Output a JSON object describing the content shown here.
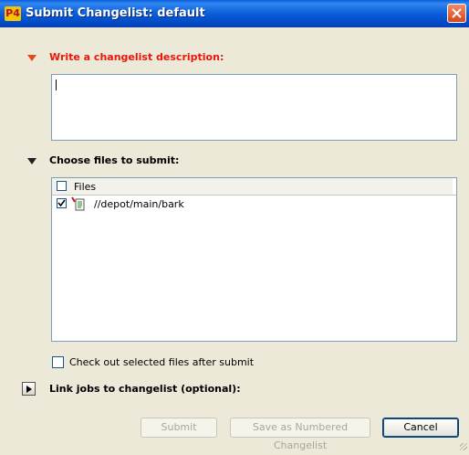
{
  "window": {
    "app_icon_text": "P4",
    "title": "Submit Changelist: default",
    "close_icon": "close-icon"
  },
  "description_section": {
    "label": "Write a changelist description:",
    "value": "",
    "accent_color": "#e8180a"
  },
  "files_section": {
    "label": "Choose files to submit:",
    "column_header": "Files",
    "header_checked": false,
    "files": [
      {
        "path": "//depot/main/bark",
        "checked": true,
        "icon": "file-edit-icon"
      }
    ]
  },
  "options": {
    "checkout_after_submit_label": "Check out selected files after submit",
    "checkout_after_submit_checked": false
  },
  "jobs_section": {
    "label": "Link jobs to changelist (optional):",
    "expanded": false
  },
  "buttons": {
    "submit": "Submit",
    "save_numbered": "Save as Numbered Changelist",
    "cancel": "Cancel"
  }
}
